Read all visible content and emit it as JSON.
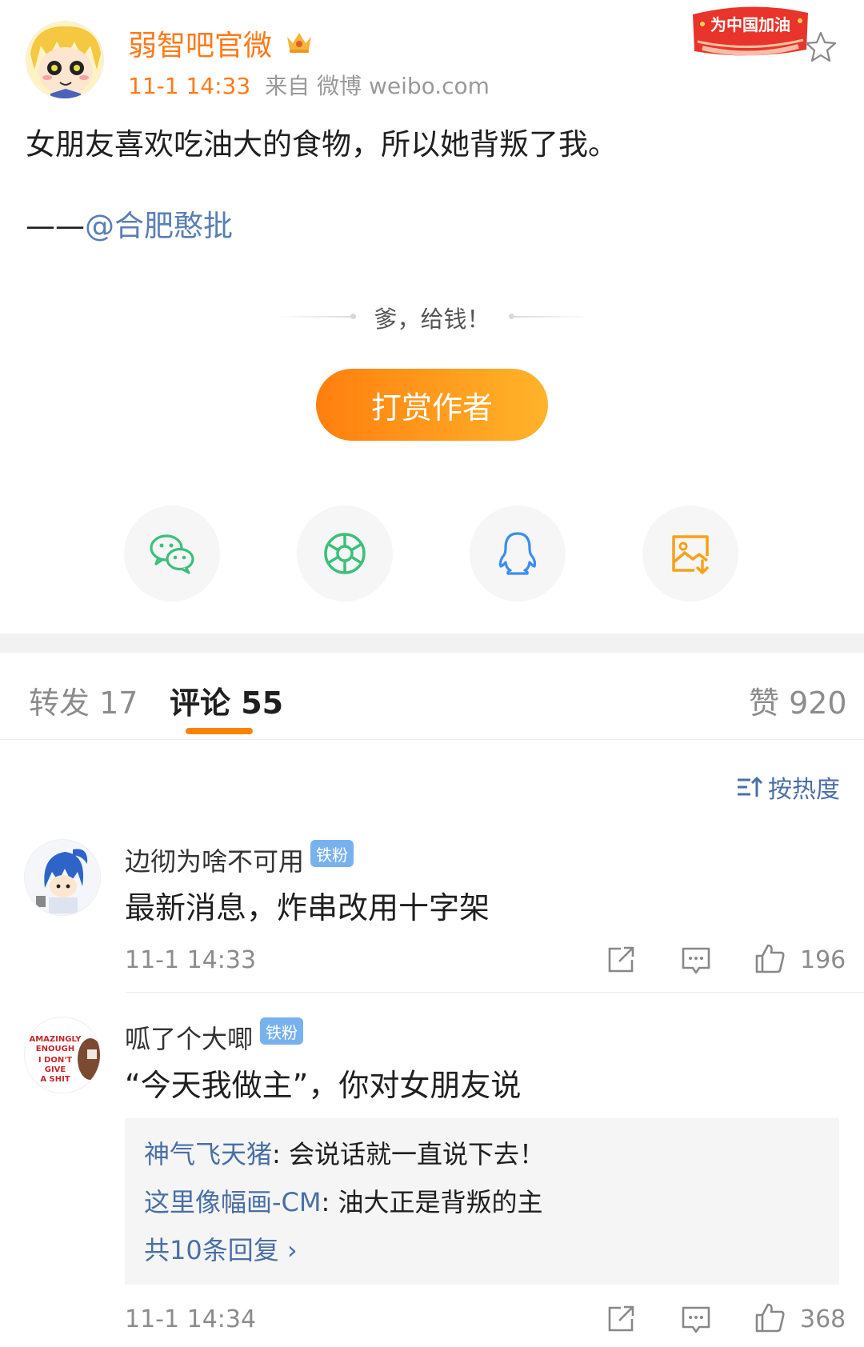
{
  "post": {
    "author": "弱智吧官微",
    "time": "11-1 14:33",
    "source": "来自 微博 weibo.com",
    "badge_text": "为中国加油",
    "text": "女朋友喜欢吃油大的食物，所以她背叛了我。",
    "credit_prefix": "——",
    "credit_mention": "@合肥憨批"
  },
  "reward": {
    "prompt": "爹，给钱！",
    "button_label": "打赏作者"
  },
  "share": [
    "wechat-icon",
    "moments-icon",
    "qq-icon",
    "save-image-icon"
  ],
  "tabs": {
    "repost": "转发 17",
    "comments": "评论 55",
    "likes": "赞 920"
  },
  "sort": {
    "label": "按热度"
  },
  "comments": [
    {
      "user": "边彻为啥不可用",
      "badge": "铁粉",
      "text": "最新消息，炸串改用十字架",
      "time": "11-1 14:33",
      "likes": "196"
    },
    {
      "user": "呱了个大唧",
      "badge": "铁粉",
      "text": "“今天我做主”，你对女朋友说",
      "time": "11-1 14:34",
      "likes": "368",
      "avatar_text": [
        "AMAZINGLY",
        "ENOUGH",
        "I DON'T",
        "GIVE",
        "A SHIT"
      ],
      "replies": [
        {
          "user": "神气飞天猪",
          "text": ": 会说话就一直说下去！"
        },
        {
          "user": "这里像幅画-CM",
          "text": ": 油大正是背叛的主"
        }
      ],
      "more_replies": "共10条回复 ›"
    }
  ],
  "colors": {
    "accent": "#ff8200",
    "link": "#4a6fa5",
    "username": "#ff7a1a"
  }
}
